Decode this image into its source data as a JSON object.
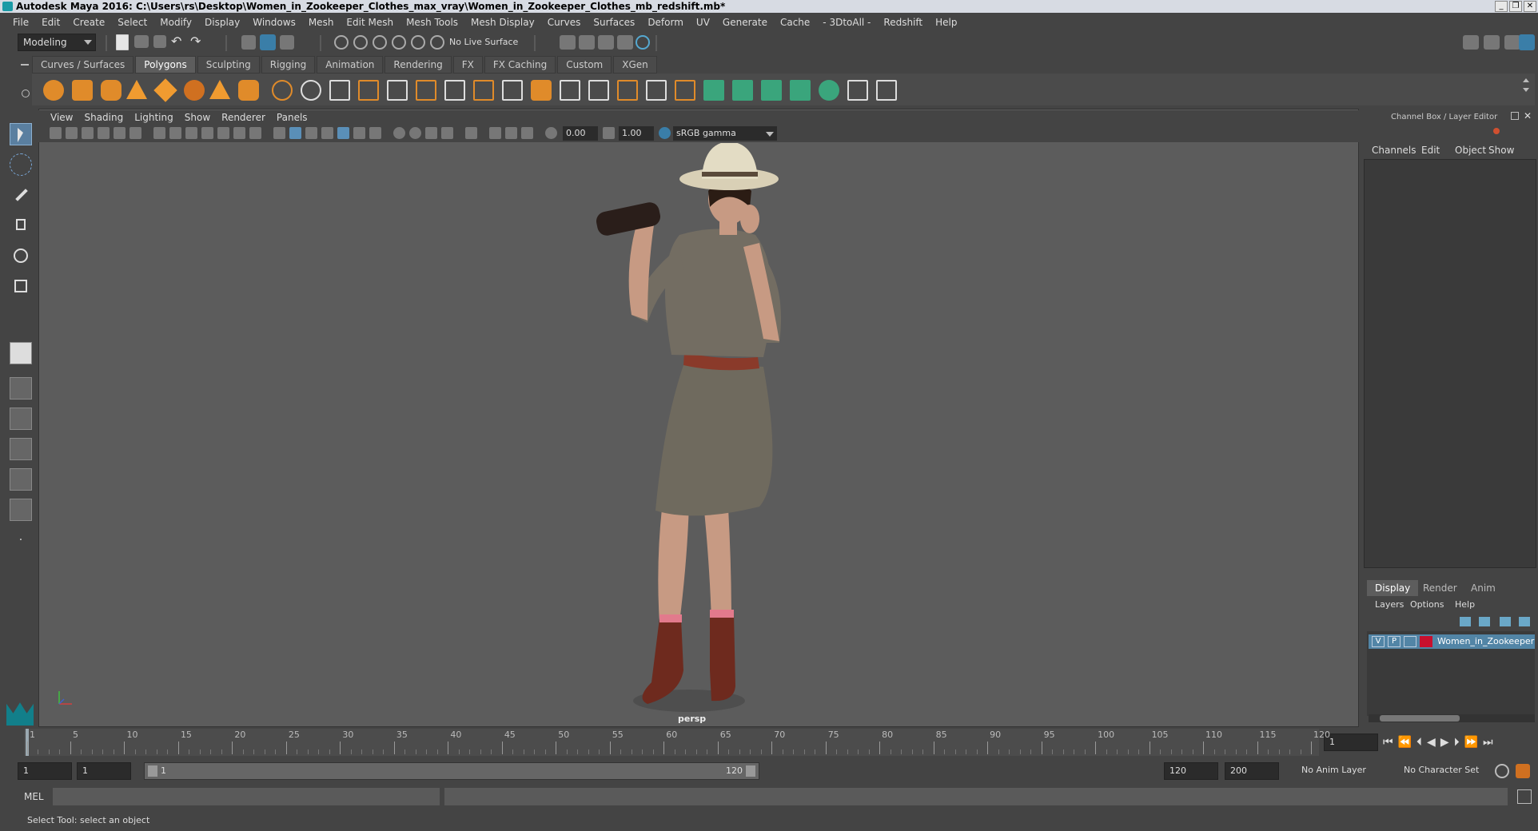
{
  "window": {
    "title": "Autodesk Maya 2016: C:\\Users\\rs\\Desktop\\Women_in_Zookeeper_Clothes_max_vray\\Women_in_Zookeeper_Clothes_mb_redshift.mb*",
    "minimize": "_",
    "restore": "❐",
    "close": "✕"
  },
  "menubar": [
    "File",
    "Edit",
    "Create",
    "Select",
    "Modify",
    "Display",
    "Windows",
    "Mesh",
    "Edit Mesh",
    "Mesh Tools",
    "Mesh Display",
    "Curves",
    "Surfaces",
    "Deform",
    "UV",
    "Generate",
    "Cache",
    "- 3DtoAll -",
    "Redshift",
    "Help"
  ],
  "statusline": {
    "mode": "Modeling",
    "live_surface": "No Live Surface"
  },
  "shelf_tabs": [
    "Curves / Surfaces",
    "Polygons",
    "Sculpting",
    "Rigging",
    "Animation",
    "Rendering",
    "FX",
    "FX Caching",
    "Custom",
    "XGen"
  ],
  "active_shelf": "Polygons",
  "panel_menu": [
    "View",
    "Shading",
    "Lighting",
    "Show",
    "Renderer",
    "Panels"
  ],
  "panel_toolbar": {
    "exposure": "0.00",
    "gamma": "1.00",
    "color_space": "sRGB gamma"
  },
  "viewport": {
    "camera": "persp"
  },
  "right_panel": {
    "header": "Channel Box / Layer Editor",
    "menu": [
      "Channels",
      "Edit",
      "Object",
      "Show"
    ],
    "tabs": [
      "Display",
      "Render",
      "Anim"
    ],
    "active_tab": "Display",
    "layer_menu": [
      "Layers",
      "Options",
      "Help"
    ],
    "layer": {
      "v": "V",
      "p": "P",
      "name": "Women_in_Zookeeper",
      "color": "#c8102e"
    }
  },
  "timeline": {
    "ticks": [
      "1",
      "5",
      "10",
      "15",
      "20",
      "25",
      "30",
      "35",
      "40",
      "45",
      "50",
      "55",
      "60",
      "65",
      "70",
      "75",
      "80",
      "85",
      "90",
      "95",
      "100",
      "105",
      "110",
      "115",
      "120"
    ],
    "current_frame": "1"
  },
  "range": {
    "start": "1",
    "playback_start": "1",
    "slider_start": "1",
    "slider_end": "120",
    "playback_end": "120",
    "end": "200",
    "anim_layer": "No Anim Layer",
    "character_set": "No Character Set"
  },
  "command": {
    "lang": "MEL"
  },
  "help_line": "Select Tool: select an object"
}
